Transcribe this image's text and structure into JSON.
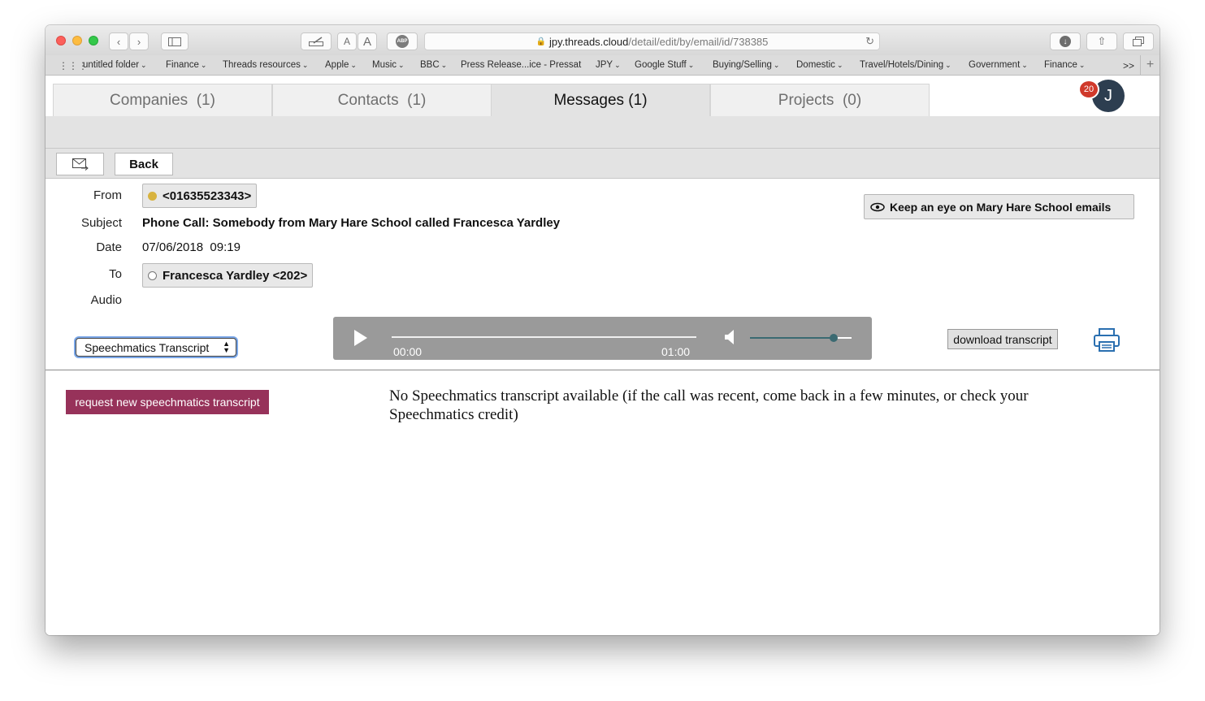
{
  "browser": {
    "url_host": "jpy.threads.cloud",
    "url_path": "/detail/edit/by/email/id/738385",
    "text_small": "A",
    "text_large": "A",
    "abp_label": "ABP",
    "overflow_label": ">>",
    "new_tab_label": "+"
  },
  "bookmarks": [
    {
      "label": "untitled folder",
      "has_menu": true
    },
    {
      "label": "Finance",
      "has_menu": true
    },
    {
      "label": "Threads resources",
      "has_menu": true
    },
    {
      "label": "Apple",
      "has_menu": true
    },
    {
      "label": "Music",
      "has_menu": true
    },
    {
      "label": "BBC",
      "has_menu": true
    },
    {
      "label": "Press Release...ice - Pressat",
      "has_menu": false
    },
    {
      "label": "JPY",
      "has_menu": true
    },
    {
      "label": "Google Stuff",
      "has_menu": true
    },
    {
      "label": "Buying/Selling",
      "has_menu": true
    },
    {
      "label": "Domestic",
      "has_menu": true
    },
    {
      "label": "Travel/Hotels/Dining",
      "has_menu": true
    },
    {
      "label": "Government",
      "has_menu": true
    },
    {
      "label": "Finance",
      "has_menu": true
    }
  ],
  "tabs": [
    {
      "label": "Companies  (1)",
      "active": false
    },
    {
      "label": "Contacts  (1)",
      "active": false
    },
    {
      "label": "Messages (1)",
      "active": true
    },
    {
      "label": "Projects  (0)",
      "active": false
    }
  ],
  "user": {
    "initial": "J",
    "notifications": "20"
  },
  "actions": {
    "back_label": "Back"
  },
  "message": {
    "from_label": "From",
    "from_value": "<01635523343>",
    "subject_label": "Subject",
    "subject_value": "Phone Call: Somebody from Mary Hare School called Francesca Yardley",
    "date_label": "Date",
    "date_value": "07/06/2018  09:19",
    "to_label": "To",
    "to_value": "Francesca Yardley <202>",
    "audio_label": "Audio",
    "keep_eye_label": "Keep an eye on Mary Hare School emails"
  },
  "transcript": {
    "selected_source": "Speechmatics Transcript",
    "download_label": "download transcript",
    "request_label": "request new speechmatics transcript",
    "message": "No Speechmatics transcript available (if the call was recent, come back in a few minutes, or check your Speechmatics credit)"
  },
  "player": {
    "current_time": "00:00",
    "duration": "01:00",
    "volume": 0.82
  },
  "colors": {
    "request_button": "#97325a",
    "avatar": "#2d3e50",
    "notification": "#d0392b",
    "from_dot": "#d8b33f"
  }
}
